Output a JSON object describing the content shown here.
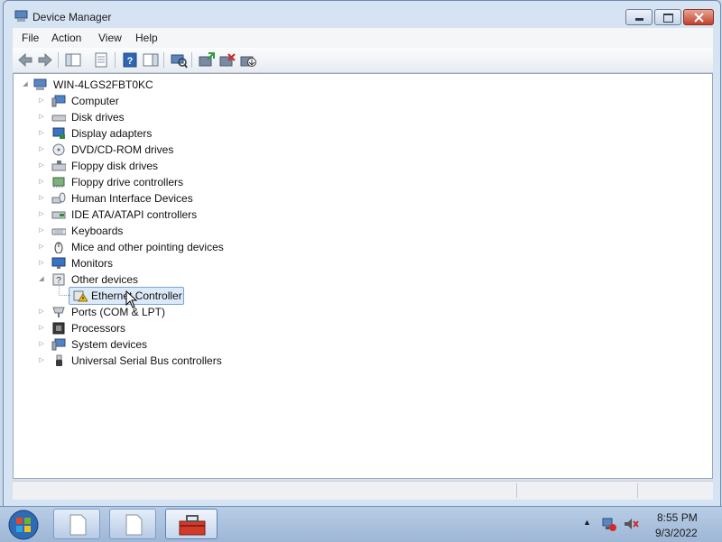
{
  "window": {
    "title": "Device Manager"
  },
  "menubar": {
    "items": [
      {
        "label": "File",
        "name": "menu-file"
      },
      {
        "label": "Action",
        "name": "menu-action"
      },
      {
        "label": "View",
        "name": "menu-view"
      },
      {
        "label": "Help",
        "name": "menu-help"
      }
    ]
  },
  "toolbar": {
    "buttons": [
      "back-arrow-icon",
      "forward-arrow-icon",
      "show-hide-console-tree-icon",
      "properties-icon",
      "help-icon",
      "action-pane-icon",
      "scan-hardware-icon",
      "update-driver-icon",
      "uninstall-device-icon",
      "disable-device-icon"
    ]
  },
  "tree": {
    "root": {
      "label": "WIN-4LGS2FBT0KC",
      "icon": "computer-root-icon"
    },
    "categories": [
      {
        "label": "Computer",
        "icon": "computer-icon"
      },
      {
        "label": "Disk drives",
        "icon": "disk-drive-icon"
      },
      {
        "label": "Display adapters",
        "icon": "display-adapter-icon"
      },
      {
        "label": "DVD/CD-ROM drives",
        "icon": "dvd-drive-icon"
      },
      {
        "label": "Floppy disk drives",
        "icon": "floppy-drive-icon"
      },
      {
        "label": "Floppy drive controllers",
        "icon": "floppy-controller-icon"
      },
      {
        "label": "Human Interface Devices",
        "icon": "hid-icon"
      },
      {
        "label": "IDE ATA/ATAPI controllers",
        "icon": "ide-controller-icon"
      },
      {
        "label": "Keyboards",
        "icon": "keyboard-icon"
      },
      {
        "label": "Mice and other pointing devices",
        "icon": "mouse-icon"
      },
      {
        "label": "Monitors",
        "icon": "monitor-icon"
      },
      {
        "label": "Other devices",
        "icon": "unknown-device-icon",
        "expanded": true
      },
      {
        "label": "Ethernet Controller",
        "icon": "warning-device-icon",
        "child": true,
        "selected": true
      },
      {
        "label": "Ports (COM & LPT)",
        "icon": "port-icon"
      },
      {
        "label": "Processors",
        "icon": "processor-icon"
      },
      {
        "label": "System devices",
        "icon": "system-device-icon"
      },
      {
        "label": "Universal Serial Bus controllers",
        "icon": "usb-controller-icon"
      }
    ]
  },
  "taskbar": {
    "clock_time": "8:55 PM",
    "clock_date": "9/3/2022",
    "tray_icons": [
      "show-hidden-icons-icon",
      "network-icon",
      "volume-muted-icon"
    ],
    "buttons": [
      "file-explorer-icon",
      "document-icon",
      "device-manager-toolbox-icon"
    ]
  },
  "colors": {
    "selection": "#dce9f8",
    "selection_border": "#7da2ce",
    "window_frame": "#d6e3f3",
    "taskbar": "#b8cde6"
  }
}
